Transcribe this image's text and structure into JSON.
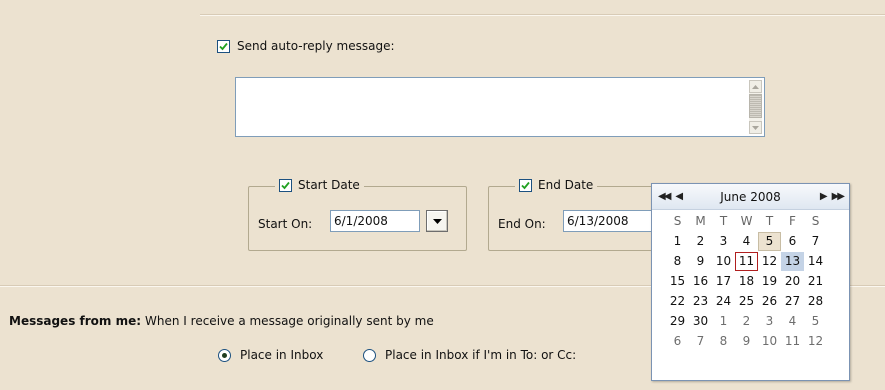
{
  "auto_reply": {
    "checkbox_label": "Send auto-reply message:",
    "checked": true,
    "message_value": ""
  },
  "start_date": {
    "group_label": "Start Date",
    "checked": true,
    "field_label": "Start On:",
    "value": "6/1/2008"
  },
  "end_date": {
    "group_label": "End Date",
    "checked": true,
    "field_label": "End On:",
    "value": "6/13/2008"
  },
  "calendar": {
    "month_label": "June 2008",
    "nav": {
      "prev_year": "◀◀",
      "prev_month": "◀",
      "next_month": "▶",
      "next_year": "▶▶"
    },
    "weekday_headers": [
      "S",
      "M",
      "T",
      "W",
      "T",
      "F",
      "S"
    ],
    "weeks": [
      [
        "1",
        "2",
        "3",
        "4",
        "5",
        "6",
        "7"
      ],
      [
        "8",
        "9",
        "10",
        "11",
        "12",
        "13",
        "14"
      ],
      [
        "15",
        "16",
        "17",
        "18",
        "19",
        "20",
        "21"
      ],
      [
        "22",
        "23",
        "24",
        "25",
        "26",
        "27",
        "28"
      ],
      [
        "29",
        "30",
        "1",
        "2",
        "3",
        "4",
        "5"
      ],
      [
        "6",
        "7",
        "8",
        "9",
        "10",
        "11",
        "12"
      ]
    ],
    "today": "11",
    "highlighted": [
      "5",
      "13"
    ]
  },
  "messages_from_me": {
    "label": "Messages from me:",
    "description": "When I receive a message originally sent by me",
    "options": [
      {
        "label": "Place in Inbox",
        "selected": true
      },
      {
        "label": "Place in Inbox if I'm in To: or Cc:",
        "selected": false
      }
    ]
  }
}
